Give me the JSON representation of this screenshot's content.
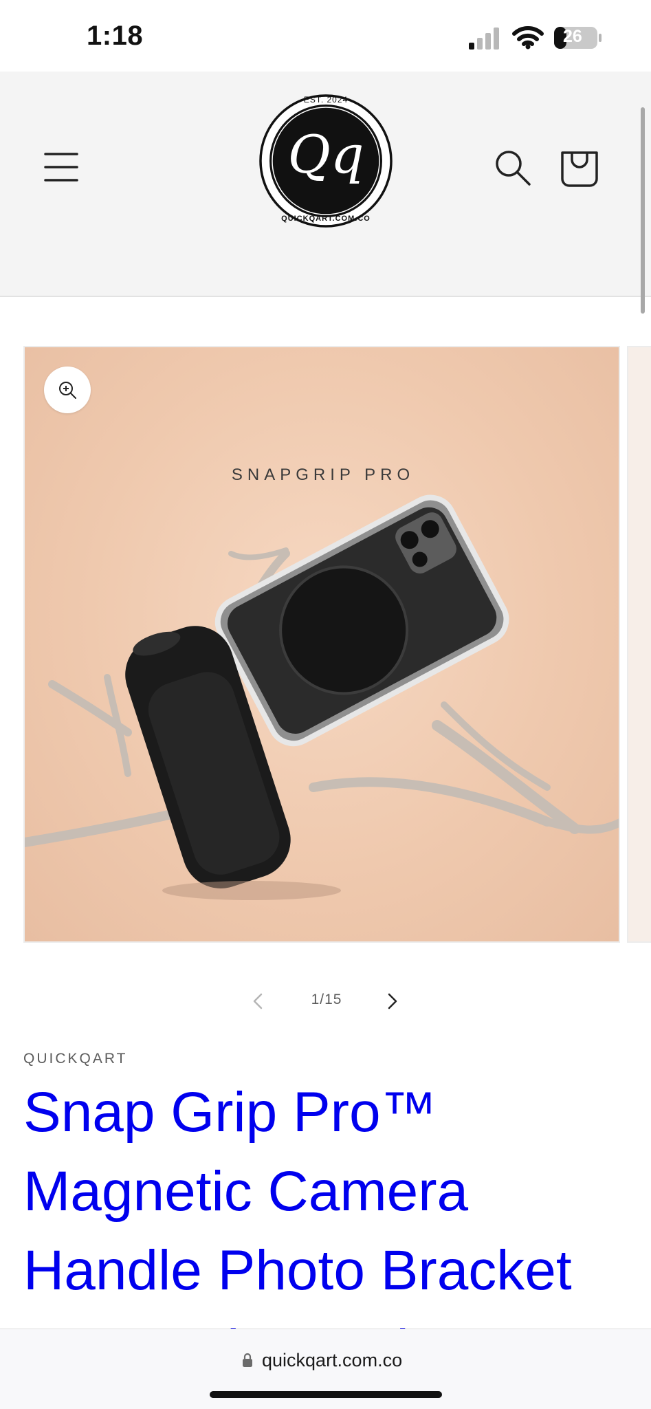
{
  "status_bar": {
    "time": "1:18",
    "battery": "26"
  },
  "header": {
    "logo": {
      "top_text": "EST. 2024",
      "monogram": "Qq",
      "bottom_text": "QUICKQART.COM.CO"
    },
    "icons": [
      "hamburger-menu-icon",
      "search-icon",
      "shopping-bag-icon"
    ]
  },
  "gallery": {
    "image_caption": "SNAPGRIP PRO",
    "counter": "1/15",
    "current_slide": 1,
    "total_slides": 15
  },
  "product": {
    "vendor": "QUICKQART",
    "title": "Snap Grip Pro™ Magnetic Camera Handle Photo Bracket Smart Bluetooth"
  },
  "browser": {
    "url": "quickqart.com.co"
  },
  "colors": {
    "title_link": "#0000ee",
    "header_bg": "#f4f4f4",
    "image_bg": "#efc9ae"
  }
}
